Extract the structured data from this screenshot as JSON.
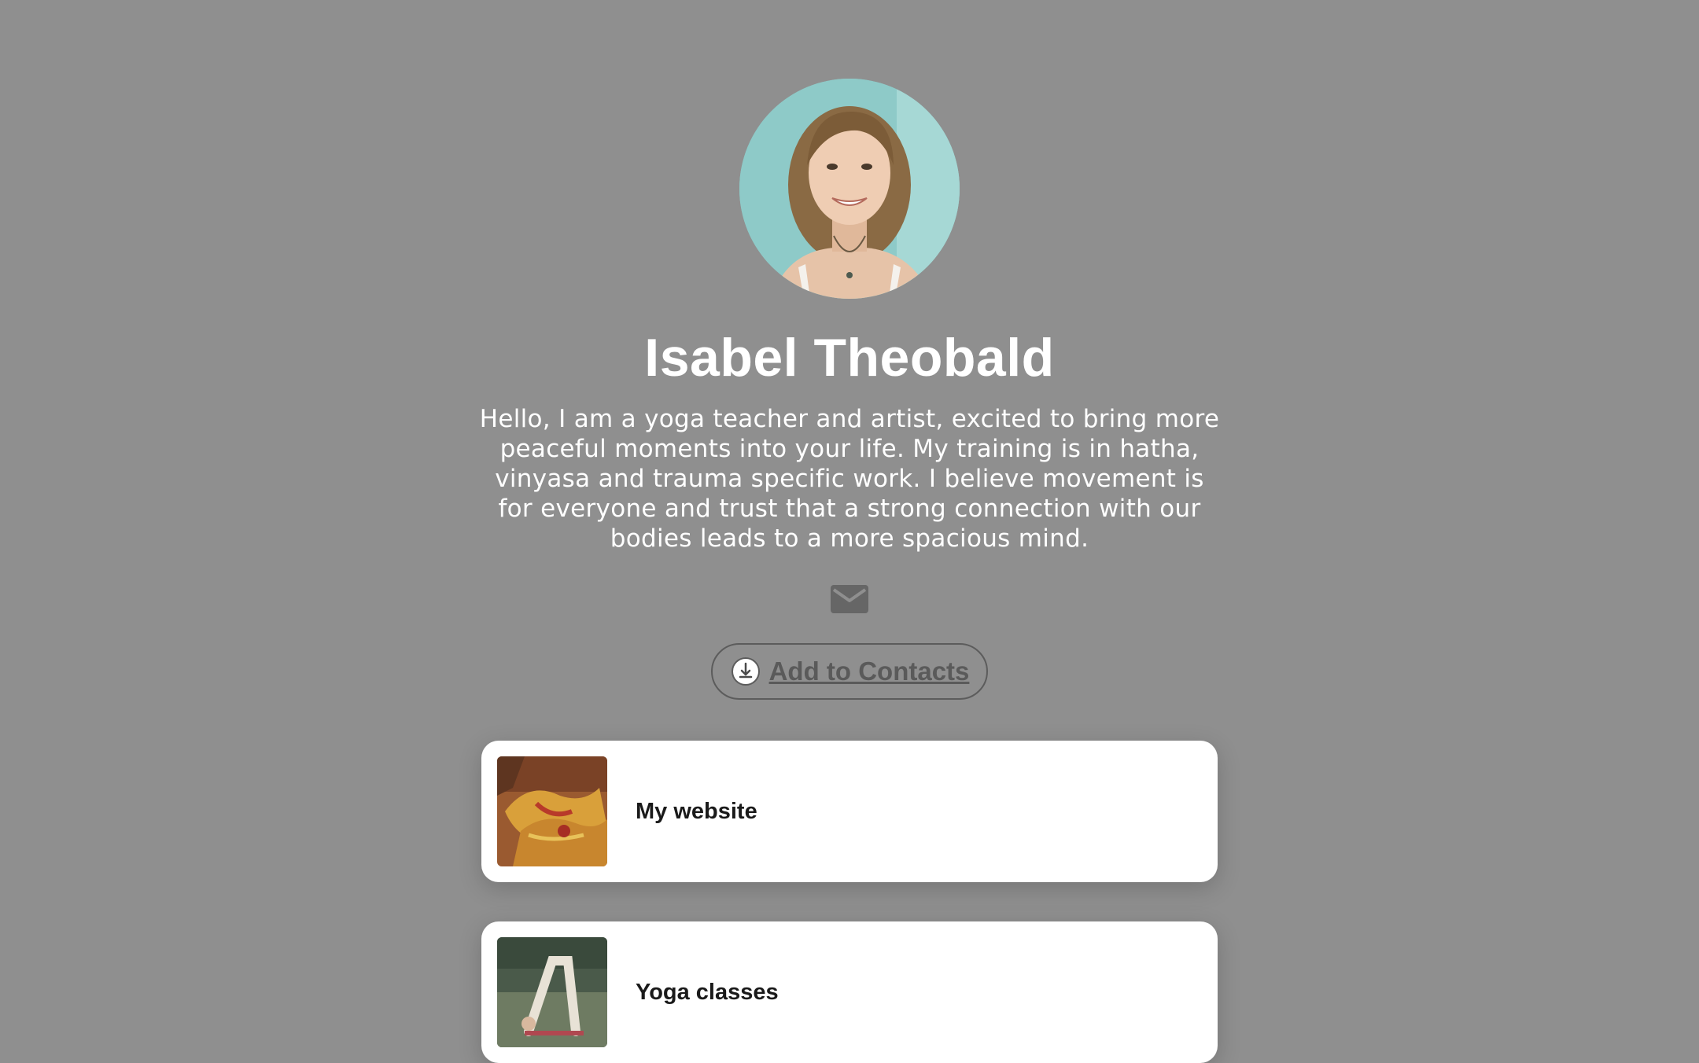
{
  "profile": {
    "name": "Isabel Theobald",
    "bio": "Hello, I am a yoga teacher and artist, excited to bring more peaceful moments into your life. My training is in hatha, vinyasa and trauma specific work. I believe movement is for everyone and trust that a strong connection with our bodies leads to a more spacious mind.",
    "avatar_icon": "profile-photo"
  },
  "actions": {
    "email_icon": "mail-icon",
    "add_contacts_label": "Add to Contacts",
    "add_contacts_icon": "download-icon"
  },
  "links": [
    {
      "label": "My website",
      "thumbnail": "painted-hands-image"
    },
    {
      "label": "Yoga classes",
      "thumbnail": "yoga-pose-image"
    }
  ],
  "colors": {
    "background": "#8f8f8f",
    "card": "#ffffff",
    "text_light": "#ffffff",
    "button_text": "#5a5a5a"
  }
}
